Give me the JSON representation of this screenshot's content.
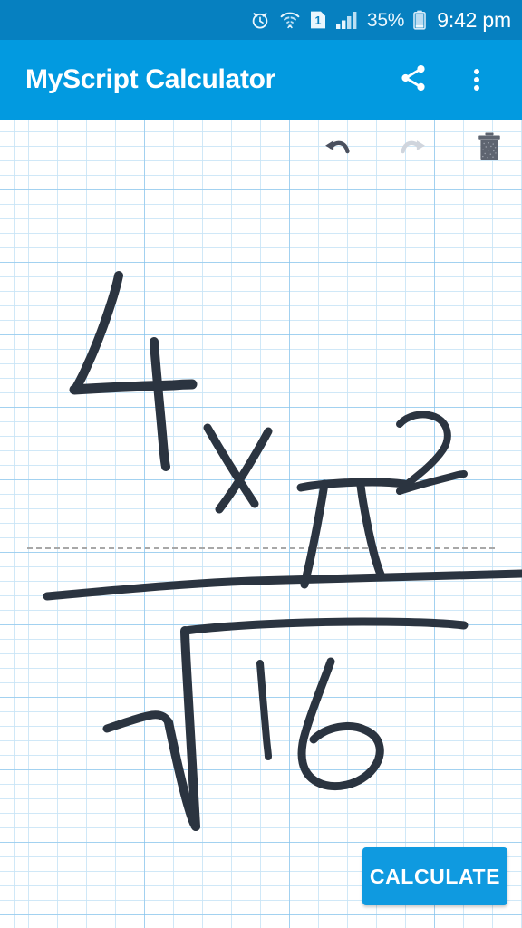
{
  "status_bar": {
    "background": "#0680c0",
    "icons": [
      {
        "name": "alarm-clock-icon"
      },
      {
        "name": "wifi-icon"
      },
      {
        "name": "sim-card-1-icon",
        "label": "1"
      },
      {
        "name": "signal-bars-icon"
      }
    ],
    "battery_percent": "35%",
    "battery_icon": "battery-icon",
    "time": "9:42 pm"
  },
  "app_bar": {
    "background": "#029ae0",
    "title": "MyScript Calculator",
    "share_icon": "share-icon",
    "overflow_icon": "overflow-menu-icon"
  },
  "canvas": {
    "grid_minor_color": "#c8e4f6",
    "grid_major_color": "#7dbeeb",
    "ink_color": "#2b3440",
    "guide_line_color": "#a8a8a8",
    "expression": {
      "numerator": "4 x π²",
      "denominator": "√16",
      "full": "(4 × π²) / √16"
    }
  },
  "toolbar": {
    "undo": {
      "name": "undo-icon",
      "enabled": true,
      "color": "#4a505e"
    },
    "redo": {
      "name": "redo-icon",
      "enabled": false,
      "color": "#d2d6dd"
    },
    "delete": {
      "name": "trash-icon",
      "enabled": true,
      "color": "#5e6470"
    }
  },
  "actions": {
    "calculate_label": "CALCULATE",
    "calculate_color": "#0f9ae0"
  }
}
